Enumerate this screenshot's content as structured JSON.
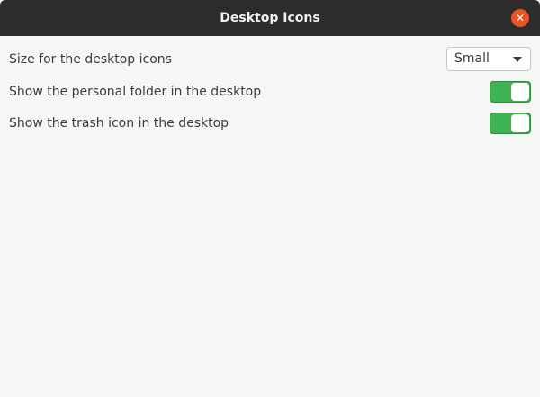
{
  "window": {
    "title": "Desktop Icons",
    "close_icon": "close-icon"
  },
  "settings": [
    {
      "label": "Size for the desktop icons",
      "type": "dropdown",
      "value": "Small"
    },
    {
      "label": "Show the personal folder in the desktop",
      "type": "toggle",
      "on": true
    },
    {
      "label": "Show the trash icon in the desktop",
      "type": "toggle",
      "on": true
    }
  ],
  "colors": {
    "toggle_on": "#3eb34f",
    "close": "#e95420"
  }
}
